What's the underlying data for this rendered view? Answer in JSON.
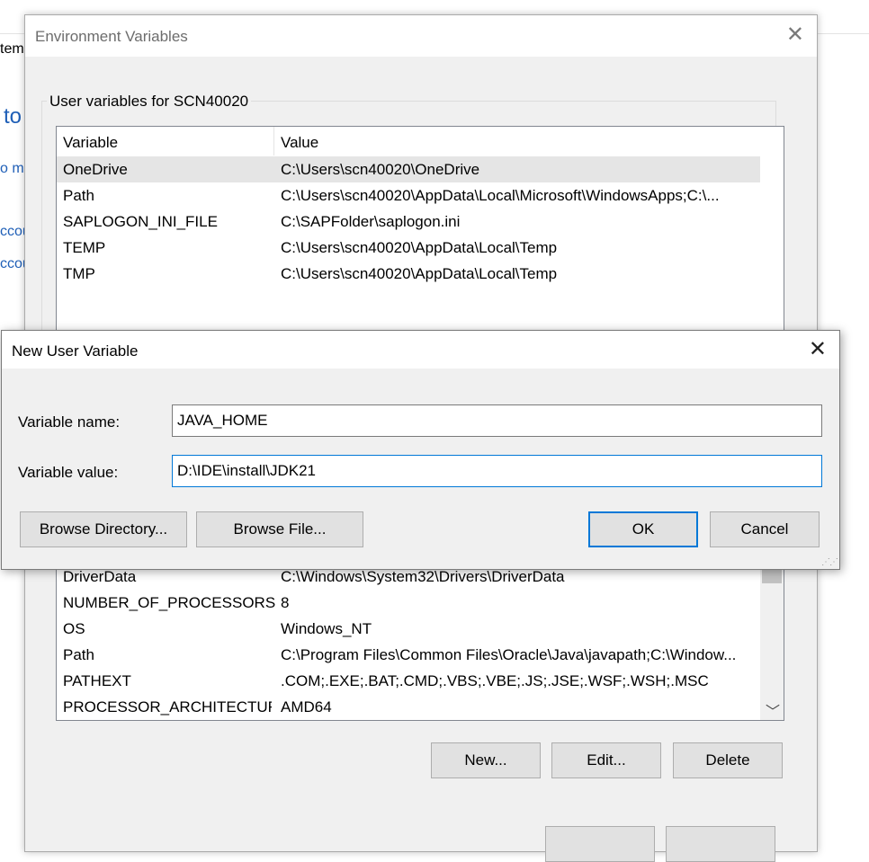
{
  "background": {
    "frag_1": "tem",
    "frag_2": "to",
    "frag_3": "o m",
    "frag_4": "ccou",
    "frag_5": "ccou"
  },
  "env_dialog": {
    "title": "Environment Variables",
    "user_group_label": "User variables for SCN40020",
    "columns": {
      "variable": "Variable",
      "value": "Value"
    },
    "user_vars": [
      {
        "name": "OneDrive",
        "value": "C:\\Users\\scn40020\\OneDrive"
      },
      {
        "name": "Path",
        "value": "C:\\Users\\scn40020\\AppData\\Local\\Microsoft\\WindowsApps;C:\\..."
      },
      {
        "name": "SAPLOGON_INI_FILE",
        "value": "C:\\SAPFolder\\saplogon.ini"
      },
      {
        "name": "TEMP",
        "value": "C:\\Users\\scn40020\\AppData\\Local\\Temp"
      },
      {
        "name": "TMP",
        "value": "C:\\Users\\scn40020\\AppData\\Local\\Temp"
      }
    ],
    "system_vars": [
      {
        "name": "DriverData",
        "value": "C:\\Windows\\System32\\Drivers\\DriverData"
      },
      {
        "name": "NUMBER_OF_PROCESSORS",
        "value": "8"
      },
      {
        "name": "OS",
        "value": "Windows_NT"
      },
      {
        "name": "Path",
        "value": "C:\\Program Files\\Common Files\\Oracle\\Java\\javapath;C:\\Window..."
      },
      {
        "name": "PATHEXT",
        "value": ".COM;.EXE;.BAT;.CMD;.VBS;.VBE;.JS;.JSE;.WSF;.WSH;.MSC"
      },
      {
        "name": "PROCESSOR_ARCHITECTURE",
        "value": "AMD64"
      }
    ],
    "buttons": {
      "new": "New...",
      "edit": "Edit...",
      "delete": "Delete"
    }
  },
  "new_var_dialog": {
    "title": "New User Variable",
    "name_label": "Variable name:",
    "value_label": "Variable value:",
    "name_value": "JAVA_HOME",
    "value_value": "D:\\IDE\\install\\JDK21",
    "buttons": {
      "browse_dir": "Browse Directory...",
      "browse_file": "Browse File...",
      "ok": "OK",
      "cancel": "Cancel"
    }
  },
  "icons": {
    "close": "close-icon",
    "scroll_down": "chevron-down-icon",
    "resize": "resize-grip-icon"
  }
}
